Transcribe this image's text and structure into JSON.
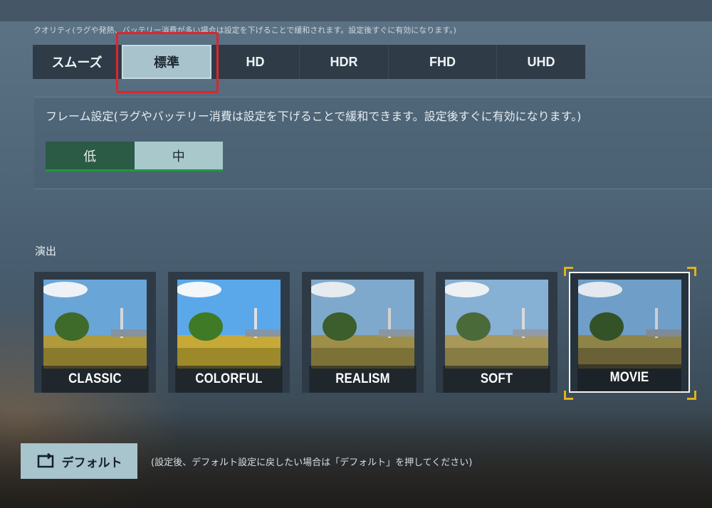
{
  "quality": {
    "note": "クオリティ(ラグや発熱、バッテリー消費が多い場合は設定を下げることで緩和されます。設定後すぐに有効になります。)",
    "options": [
      "スムーズ",
      "標準",
      "HD",
      "HDR",
      "FHD",
      "UHD"
    ],
    "selected": "標準"
  },
  "frame": {
    "title": "フレーム設定(ラグやバッテリー消費は設定を下げることで緩和できます。設定後すぐに有効になります。)",
    "options": [
      "低",
      "中"
    ],
    "selected": "中"
  },
  "effects": {
    "label": "演出",
    "styles": [
      "CLASSIC",
      "COLORFUL",
      "REALISM",
      "SOFT",
      "MOVIE"
    ],
    "selected": "MOVIE"
  },
  "footer": {
    "default_label": "デフォルト",
    "note": "(設定後、デフォルト設定に戻したい場合は「デフォルト」を押してください)"
  },
  "colors": {
    "selected_button": "#a9c3cc",
    "highlight_box": "#e0242c",
    "frame_underline": "#1f9a3c",
    "selection_corner": "#e2b21b"
  }
}
